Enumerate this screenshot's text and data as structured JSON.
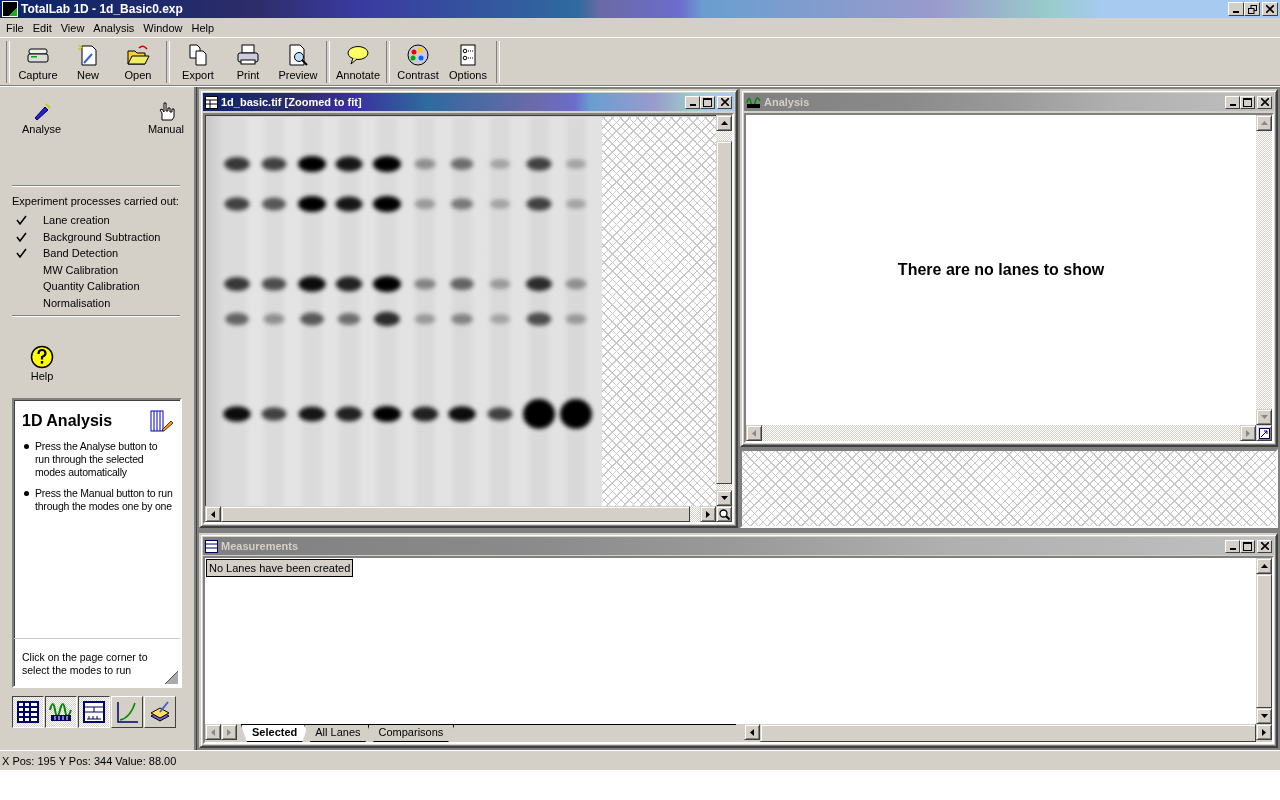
{
  "app_title": "TotalLab 1D - 1d_Basic0.exp",
  "menu": [
    "File",
    "Edit",
    "View",
    "Analysis",
    "Window",
    "Help"
  ],
  "toolbar": [
    [
      "Capture",
      "New",
      "Open"
    ],
    [
      "Export",
      "Print",
      "Preview"
    ],
    [
      "Annotate"
    ],
    [
      "Contrast",
      "Options"
    ]
  ],
  "sidebar": {
    "actions": [
      "Analyse",
      "Manual"
    ],
    "processes_heading": "Experiment processes carried out:",
    "processes": [
      {
        "label": "Lane creation",
        "checked": true
      },
      {
        "label": "Background Subtraction",
        "checked": true
      },
      {
        "label": "Band Detection",
        "checked": true
      },
      {
        "label": "MW Calibration",
        "checked": false
      },
      {
        "label": "Quantity Calibration",
        "checked": false
      },
      {
        "label": "Normalisation",
        "checked": false
      }
    ],
    "help": "Help",
    "info_card": {
      "title": "1D Analysis",
      "bullets": [
        "Press the Analyse button to run through the selected modes automatically",
        "Press the Manual button to run through the modes one by one"
      ],
      "footer": "Click on the page corner to select the modes to run"
    },
    "view_buttons": [
      {
        "selected": true
      },
      {
        "selected": true
      },
      {
        "selected": true
      },
      {
        "selected": false
      },
      {
        "selected": false
      }
    ]
  },
  "image_window": {
    "title": "1d_basic.tif [Zoomed to fit]",
    "active": true
  },
  "analysis_window": {
    "title": "Analysis",
    "active": false,
    "message": "There are no lanes to show"
  },
  "measurements_window": {
    "title": "Measurements",
    "active": false,
    "message": "No Lanes have been created",
    "tabs": [
      {
        "label": "Selected",
        "selected": true
      },
      {
        "label": "All Lanes",
        "selected": false
      },
      {
        "label": "Comparisons",
        "selected": false
      }
    ]
  },
  "status_bar": "X Pos: 195 Y Pos: 344 Value: 88.00"
}
